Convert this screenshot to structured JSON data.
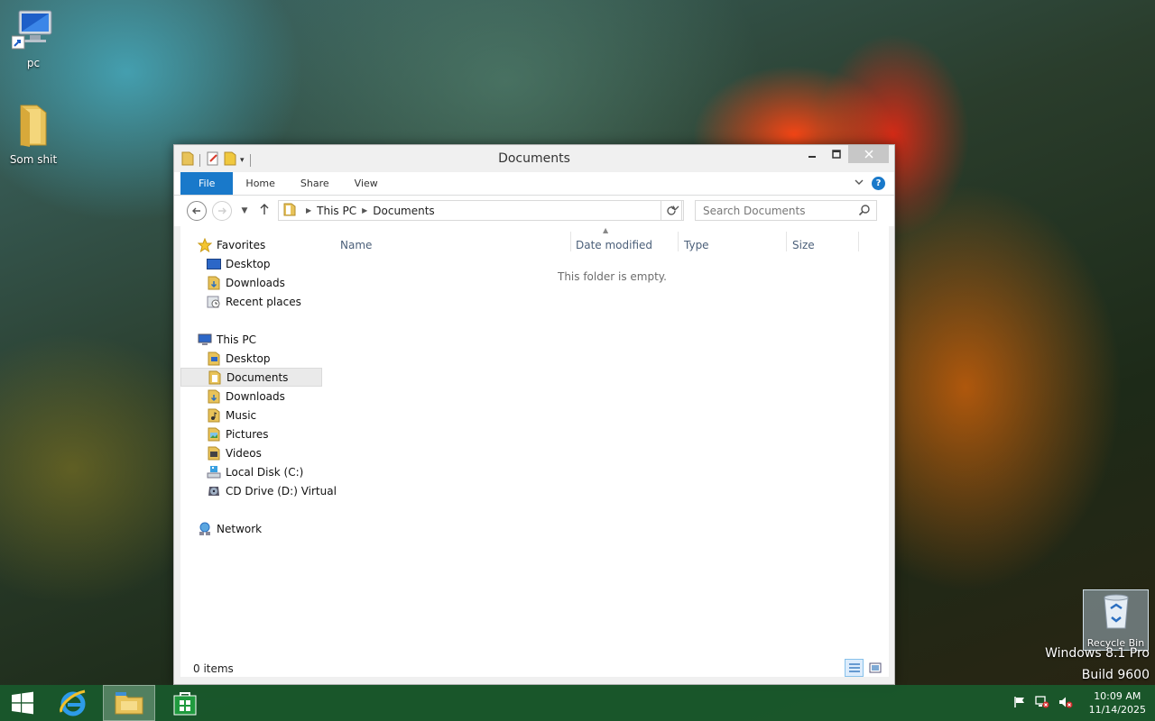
{
  "desktop": {
    "icons": [
      {
        "label": "pc"
      },
      {
        "label": "Som shit"
      },
      {
        "label": "Recycle Bin"
      }
    ],
    "watermark_line1": "Windows 8.1 Pro",
    "watermark_line2": "Build 9600"
  },
  "window": {
    "title": "Documents",
    "ribbon_tabs": [
      "File",
      "Home",
      "Share",
      "View"
    ],
    "breadcrumb": [
      "This PC",
      "Documents"
    ],
    "search_placeholder": "Search Documents",
    "nav": {
      "favorites_header": "Favorites",
      "favorites": [
        "Desktop",
        "Downloads",
        "Recent places"
      ],
      "thispc_header": "This PC",
      "thispc": [
        "Desktop",
        "Documents",
        "Downloads",
        "Music",
        "Pictures",
        "Videos",
        "Local Disk (C:)",
        "CD Drive (D:) Virtual"
      ],
      "network": "Network",
      "selected": "Documents"
    },
    "columns": [
      "Name",
      "Date modified",
      "Type",
      "Size"
    ],
    "empty_message": "This folder is empty.",
    "status_items": "0 items"
  },
  "taskbar": {
    "time": "10:09 AM",
    "date": "11/14/2025"
  },
  "colors": {
    "accent": "#1979ca",
    "taskbar": "#195a2d"
  }
}
